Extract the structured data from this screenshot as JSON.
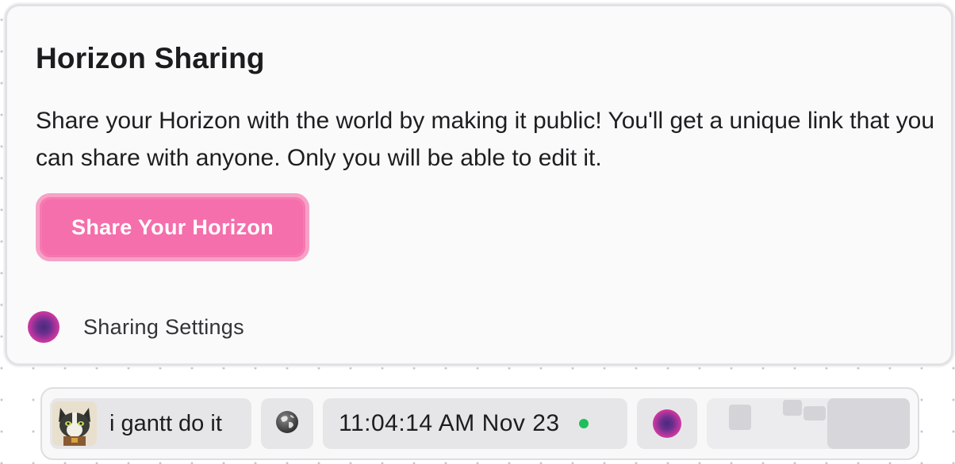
{
  "panel": {
    "title": "Horizon Sharing",
    "description": "Share your Horizon with the world by making it public! You'll get a unique link that you can share with anyone. Only you will be able to edit it.",
    "share_button_label": "Share Your Horizon",
    "settings_label": "Sharing Settings"
  },
  "dock": {
    "user_name": "i gantt do it",
    "clock": "11:04:14 AM Nov 23",
    "status_color": "#1dbf5b",
    "icons": {
      "avatar": "cat-avatar",
      "globe": "globe-icon",
      "orb": "horizon-orb-icon"
    }
  },
  "colors": {
    "accent": "#f46fab",
    "accent_border": "#f7a1c6",
    "orb_outer": "#e64aa6",
    "orb_inner": "#4b2a7a"
  }
}
